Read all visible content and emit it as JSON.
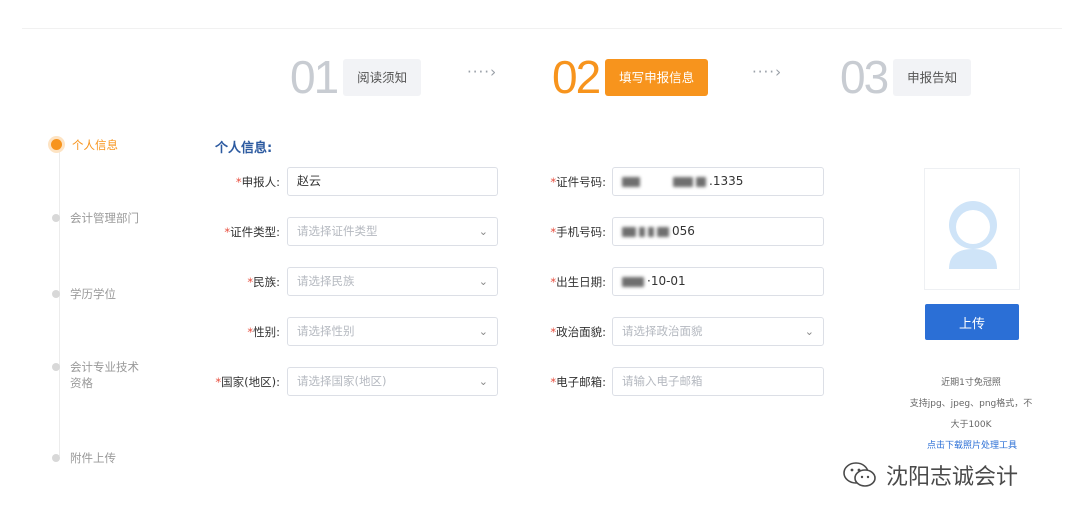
{
  "steps": [
    {
      "num": "01",
      "label": "阅读须知",
      "state": "inactive"
    },
    {
      "num": "02",
      "label": "填写申报信息",
      "state": "active"
    },
    {
      "num": "03",
      "label": "申报告知",
      "state": "inactive"
    }
  ],
  "step_arrow": "····›",
  "sidenav": [
    "个人信息",
    "会计管理部门",
    "学历学位",
    "会计专业技术资格",
    "附件上传"
  ],
  "section_title": "个人信息:",
  "form": {
    "applicant": {
      "label": "申报人:",
      "value": "赵云"
    },
    "id_type": {
      "label": "证件类型:",
      "placeholder": "请选择证件类型"
    },
    "ethnicity": {
      "label": "民族:",
      "placeholder": "请选择民族"
    },
    "gender": {
      "label": "性别:",
      "placeholder": "请选择性别"
    },
    "country": {
      "label": "国家(地区):",
      "placeholder": "请选择国家(地区)"
    },
    "id_number": {
      "label": "证件号码:",
      "value_suffix": ".1335"
    },
    "phone": {
      "label": "手机号码:",
      "value_suffix": "056"
    },
    "birth_date": {
      "label": "出生日期:",
      "value_suffix": "·10-01"
    },
    "political": {
      "label": "政治面貌:",
      "placeholder": "请选择政治面貌"
    },
    "email": {
      "label": "电子邮箱:",
      "placeholder": "请输入电子邮箱"
    }
  },
  "required_mark": "*",
  "photo": {
    "upload_label": "上传",
    "hint1": "近期1寸免冠照",
    "hint2": "支持jpg、jpeg、png格式，不",
    "hint3": "大于100K",
    "link": "点击下载照片处理工具"
  },
  "watermark": "沈阳志诚会计",
  "icons": {
    "dropdown": "chevron-down-icon",
    "avatar": "avatar-icon",
    "wechat": "wechat-icon"
  },
  "colors": {
    "accent": "#f7941d",
    "primary": "#2b6fd6",
    "title": "#2c5aa0",
    "required": "#e74c3c"
  }
}
